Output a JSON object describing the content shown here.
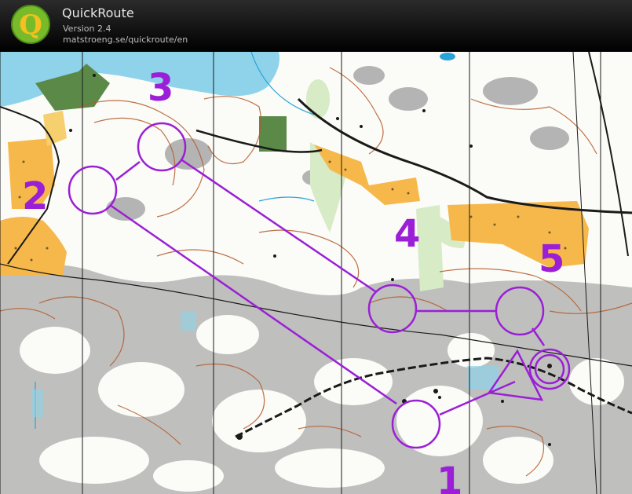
{
  "app": {
    "title": "QuickRoute",
    "version": "Version 2.4",
    "url": "matstroeng.se/quickroute/en",
    "logo_letter": "Q",
    "logo_icon": "quickroute-q-logo"
  },
  "course": {
    "color": "#9b1fd6",
    "controls": [
      {
        "number": "1"
      },
      {
        "number": "2"
      },
      {
        "number": "3"
      },
      {
        "number": "4"
      },
      {
        "number": "5"
      }
    ]
  },
  "map_colors": {
    "water": "#8fd3ea",
    "open_land": "#f6b84a",
    "rock": "#b0b0b0",
    "green": "#d6ebc6",
    "contour": "#b35a2a",
    "paths": "#1a1a1a"
  }
}
